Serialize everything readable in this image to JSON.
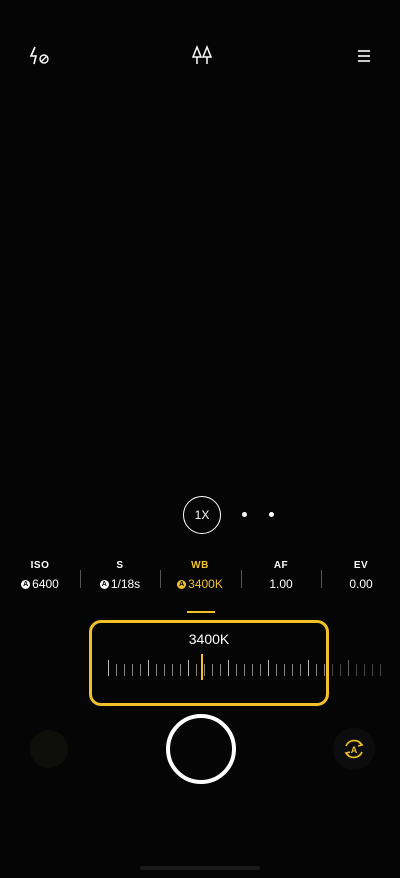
{
  "topbar": {
    "flash_icon": "flash-off-icon",
    "filter_icon": "filter-icon",
    "menu_icon": "menu-icon"
  },
  "zoom": {
    "label": "1X"
  },
  "params": [
    {
      "label": "ISO",
      "value": "6400",
      "auto": true,
      "active": false
    },
    {
      "label": "S",
      "value": "1/18s",
      "auto": true,
      "active": false
    },
    {
      "label": "WB",
      "value": "3400K",
      "auto": true,
      "active": true
    },
    {
      "label": "AF",
      "value": "1.00",
      "auto": false,
      "active": false
    },
    {
      "label": "EV",
      "value": "0.00",
      "auto": false,
      "active": false
    }
  ],
  "auto_badge": "A",
  "wb_panel": {
    "value": "3400K"
  },
  "bottom": {
    "switch_icon": "auto-rotate-icon",
    "switch_label": "A"
  },
  "colors": {
    "accent": "#f0c128",
    "background": "#000000"
  }
}
